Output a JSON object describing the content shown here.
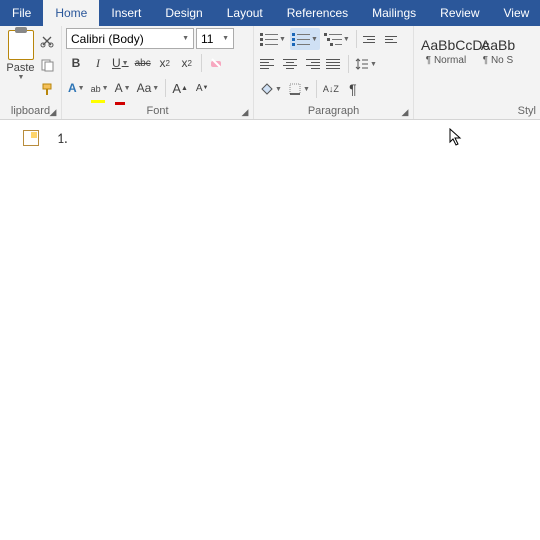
{
  "tabs": {
    "file": "File",
    "home": "Home",
    "insert": "Insert",
    "design": "Design",
    "layout": "Layout",
    "references": "References",
    "mailings": "Mailings",
    "review": "Review",
    "view": "View"
  },
  "clipboard": {
    "paste": "Paste",
    "group_label": "lipboard"
  },
  "font": {
    "name": "Calibri (Body)",
    "size": "11",
    "b": "B",
    "i": "I",
    "u": "U",
    "abc": "abc",
    "x2sub": "x",
    "x2sup": "x",
    "A_fill": "A",
    "A_color": "A",
    "Aa": "Aa",
    "Agrow": "A",
    "Ashrink": "A",
    "group_label": "Font"
  },
  "paragraph": {
    "group_label": "Paragraph",
    "sort": "A↓Z",
    "pilcrow": "¶"
  },
  "styles": {
    "sample1": "AaBbCcDc",
    "name1": "¶ Normal",
    "sample2": "AaBb",
    "name2": "¶ No S",
    "group_label": "Styl"
  },
  "doc": {
    "list1": "1."
  }
}
